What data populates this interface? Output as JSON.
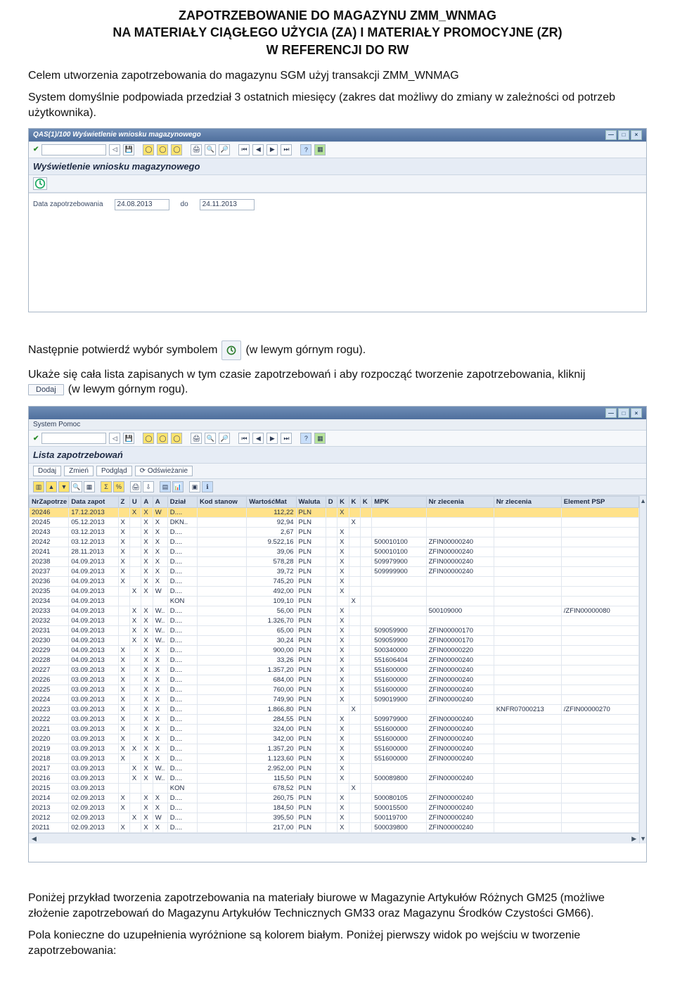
{
  "doc": {
    "title1": "ZAPOTRZEBOWANIE DO MAGAZYNU ZMM_WNMAG",
    "title2": "NA MATERIAŁY CIĄGŁEGO UŻYCIA (ZA) I MATERIAŁY PROMOCYJNE (ZR)",
    "title3": "W REFERENCJI DO RW",
    "p1": "Celem utworzenia zapotrzebowania do magazynu SGM użyj transakcji ZMM_WNMAG",
    "p2": "System domyślnie podpowiada przedział 3 ostatnich miesięcy (zakres dat możliwy do zmiany w zależności od potrzeb użytkownika).",
    "p3a": "Następnie potwierdź wybór symbolem",
    "p3b": "(w lewym górnym rogu).",
    "p4": "Ukaże się cała lista zapisanych w tym czasie zapotrzebowań i aby rozpocząć tworzenie zapotrzebowania, kliknij",
    "p4b": "(w lewym górnym rogu).",
    "p5": "Poniżej przykład tworzenia zapotrzebowania na materiały biurowe w Magazynie Artykułów Różnych GM25 (możliwe złożenie zapotrzebowań do Magazynu Artykułów Technicznych GM33 oraz Magazynu Środków Czystości GM66).",
    "p6": "Pola konieczne do uzupełnienia wyróżnione są kolorem białym. Poniżej pierwszy widok po wejściu w tworzenie zapotrzebowania:"
  },
  "btn": {
    "dodaj": "Dodaj"
  },
  "sap1": {
    "wintitle": "QAS(1)/100 Wyświetlenie wniosku magazynowego",
    "apptitle": "Wyświetlenie wniosku magazynowego",
    "label_date": "Data zapotrzebowania",
    "date_from": "24.08.2013",
    "label_to": "do",
    "date_to": "24.11.2013"
  },
  "sap2": {
    "menu": "System    Pomoc",
    "apptitle": "Lista zapotrzebowań",
    "btn_dodaj": "Dodaj",
    "btn_zmien": "Zmień",
    "btn_podglad": "Podgląd",
    "btn_odswiez": "Odświeżanie",
    "columns": [
      "NrZapotrze",
      "Data zapot",
      "Z",
      "U",
      "A",
      "A",
      "Dział",
      "Kod stanow",
      "WartośćMat",
      "Waluta",
      "D",
      "K",
      "K",
      "K",
      "MPK",
      "Nr zlecenia",
      "Nr zlecenia",
      "Element PSP"
    ],
    "rows": [
      {
        "sel": true,
        "c": [
          "20246",
          "17.12.2013",
          "",
          "X",
          "X",
          "W",
          "D....",
          "",
          "112,22",
          "PLN",
          "",
          "X",
          "",
          "",
          "",
          "",
          "",
          ""
        ]
      },
      {
        "c": [
          "20245",
          "05.12.2013",
          "X",
          "",
          "X",
          "X",
          "DKN..",
          "",
          "92,94",
          "PLN",
          "",
          "",
          "X",
          "",
          "",
          "",
          "",
          ""
        ]
      },
      {
        "c": [
          "20243",
          "03.12.2013",
          "X",
          "",
          "X",
          "X",
          "D....",
          "",
          "2,67",
          "PLN",
          "",
          "X",
          "",
          "",
          "",
          "",
          "",
          ""
        ]
      },
      {
        "c": [
          "20242",
          "03.12.2013",
          "X",
          "",
          "X",
          "X",
          "D....",
          "",
          "9.522,16",
          "PLN",
          "",
          "X",
          "",
          "",
          "500010100",
          "ZFIN00000240",
          "",
          ""
        ]
      },
      {
        "c": [
          "20241",
          "28.11.2013",
          "X",
          "",
          "X",
          "X",
          "D....",
          "",
          "39,06",
          "PLN",
          "",
          "X",
          "",
          "",
          "500010100",
          "ZFIN00000240",
          "",
          ""
        ]
      },
      {
        "c": [
          "20238",
          "04.09.2013",
          "X",
          "",
          "X",
          "X",
          "D....",
          "",
          "578,28",
          "PLN",
          "",
          "X",
          "",
          "",
          "509979900",
          "ZFIN00000240",
          "",
          ""
        ]
      },
      {
        "c": [
          "20237",
          "04.09.2013",
          "X",
          "",
          "X",
          "X",
          "D....",
          "",
          "39,72",
          "PLN",
          "",
          "X",
          "",
          "",
          "509999900",
          "ZFIN00000240",
          "",
          ""
        ]
      },
      {
        "c": [
          "20236",
          "04.09.2013",
          "X",
          "",
          "X",
          "X",
          "D....",
          "",
          "745,20",
          "PLN",
          "",
          "X",
          "",
          "",
          "",
          "",
          "",
          ""
        ]
      },
      {
        "c": [
          "20235",
          "04.09.2013",
          "",
          "X",
          "X",
          "W",
          "D....",
          "",
          "492,00",
          "PLN",
          "",
          "X",
          "",
          "",
          "",
          "",
          "",
          ""
        ]
      },
      {
        "c": [
          "20234",
          "04.09.2013",
          "",
          "",
          "",
          "",
          "KON",
          "",
          "109,10",
          "PLN",
          "",
          "",
          "X",
          "",
          "",
          "",
          "",
          ""
        ]
      },
      {
        "c": [
          "20233",
          "04.09.2013",
          "",
          "X",
          "X",
          "W..",
          "D....",
          "",
          "56,00",
          "PLN",
          "",
          "X",
          "",
          "",
          "",
          "500109000",
          "",
          "/ZFIN00000080"
        ]
      },
      {
        "c": [
          "20232",
          "04.09.2013",
          "",
          "X",
          "X",
          "W..",
          "D....",
          "",
          "1.326,70",
          "PLN",
          "",
          "X",
          "",
          "",
          "",
          "",
          "",
          ""
        ]
      },
      {
        "c": [
          "20231",
          "04.09.2013",
          "",
          "X",
          "X",
          "W..",
          "D....",
          "",
          "65,00",
          "PLN",
          "",
          "X",
          "",
          "",
          "509059900",
          "ZFIN00000170",
          "",
          ""
        ]
      },
      {
        "c": [
          "20230",
          "04.09.2013",
          "",
          "X",
          "X",
          "W..",
          "D....",
          "",
          "30,24",
          "PLN",
          "",
          "X",
          "",
          "",
          "509059900",
          "ZFIN00000170",
          "",
          ""
        ]
      },
      {
        "c": [
          "20229",
          "04.09.2013",
          "X",
          "",
          "X",
          "X",
          "D....",
          "",
          "900,00",
          "PLN",
          "",
          "X",
          "",
          "",
          "500340000",
          "ZFIN00000220",
          "",
          ""
        ]
      },
      {
        "c": [
          "20228",
          "04.09.2013",
          "X",
          "",
          "X",
          "X",
          "D....",
          "",
          "33,26",
          "PLN",
          "",
          "X",
          "",
          "",
          "551606404",
          "ZFIN00000240",
          "",
          ""
        ]
      },
      {
        "c": [
          "20227",
          "03.09.2013",
          "X",
          "",
          "X",
          "X",
          "D....",
          "",
          "1.357,20",
          "PLN",
          "",
          "X",
          "",
          "",
          "551600000",
          "ZFIN00000240",
          "",
          ""
        ]
      },
      {
        "c": [
          "20226",
          "03.09.2013",
          "X",
          "",
          "X",
          "X",
          "D....",
          "",
          "684,00",
          "PLN",
          "",
          "X",
          "",
          "",
          "551600000",
          "ZFIN00000240",
          "",
          ""
        ]
      },
      {
        "c": [
          "20225",
          "03.09.2013",
          "X",
          "",
          "X",
          "X",
          "D....",
          "",
          "760,00",
          "PLN",
          "",
          "X",
          "",
          "",
          "551600000",
          "ZFIN00000240",
          "",
          ""
        ]
      },
      {
        "c": [
          "20224",
          "03.09.2013",
          "X",
          "",
          "X",
          "X",
          "D....",
          "",
          "749,90",
          "PLN",
          "",
          "X",
          "",
          "",
          "509019900",
          "ZFIN00000240",
          "",
          ""
        ]
      },
      {
        "c": [
          "20223",
          "03.09.2013",
          "X",
          "",
          "X",
          "X",
          "D....",
          "",
          "1.866,80",
          "PLN",
          "",
          "",
          "X",
          "",
          "",
          "",
          "KNFR07000213",
          "/ZFIN00000270"
        ]
      },
      {
        "c": [
          "20222",
          "03.09.2013",
          "X",
          "",
          "X",
          "X",
          "D....",
          "",
          "284,55",
          "PLN",
          "",
          "X",
          "",
          "",
          "509979900",
          "ZFIN00000240",
          "",
          ""
        ]
      },
      {
        "c": [
          "20221",
          "03.09.2013",
          "X",
          "",
          "X",
          "X",
          "D....",
          "",
          "324,00",
          "PLN",
          "",
          "X",
          "",
          "",
          "551600000",
          "ZFIN00000240",
          "",
          ""
        ]
      },
      {
        "c": [
          "20220",
          "03.09.2013",
          "X",
          "",
          "X",
          "X",
          "D....",
          "",
          "342,00",
          "PLN",
          "",
          "X",
          "",
          "",
          "551600000",
          "ZFIN00000240",
          "",
          ""
        ]
      },
      {
        "c": [
          "20219",
          "03.09.2013",
          "X",
          "X",
          "X",
          "X",
          "D....",
          "",
          "1.357,20",
          "PLN",
          "",
          "X",
          "",
          "",
          "551600000",
          "ZFIN00000240",
          "",
          ""
        ]
      },
      {
        "c": [
          "20218",
          "03.09.2013",
          "X",
          "",
          "X",
          "X",
          "D....",
          "",
          "1.123,60",
          "PLN",
          "",
          "X",
          "",
          "",
          "551600000",
          "ZFIN00000240",
          "",
          ""
        ]
      },
      {
        "c": [
          "20217",
          "03.09.2013",
          "",
          "X",
          "X",
          "W..",
          "D....",
          "",
          "2.952,00",
          "PLN",
          "",
          "X",
          "",
          "",
          "",
          "",
          "",
          ""
        ]
      },
      {
        "c": [
          "20216",
          "03.09.2013",
          "",
          "X",
          "X",
          "W..",
          "D....",
          "",
          "115,50",
          "PLN",
          "",
          "X",
          "",
          "",
          "500089800",
          "ZFIN00000240",
          "",
          ""
        ]
      },
      {
        "c": [
          "20215",
          "03.09.2013",
          "",
          "",
          "",
          "",
          "KON",
          "",
          "678,52",
          "PLN",
          "",
          "",
          "X",
          "",
          "",
          "",
          "",
          ""
        ]
      },
      {
        "c": [
          "20214",
          "02.09.2013",
          "X",
          "",
          "X",
          "X",
          "D....",
          "",
          "260,75",
          "PLN",
          "",
          "X",
          "",
          "",
          "500080105",
          "ZFIN00000240",
          "",
          ""
        ]
      },
      {
        "c": [
          "20213",
          "02.09.2013",
          "X",
          "",
          "X",
          "X",
          "D....",
          "",
          "184,50",
          "PLN",
          "",
          "X",
          "",
          "",
          "500015500",
          "ZFIN00000240",
          "",
          ""
        ]
      },
      {
        "c": [
          "20212",
          "02.09.2013",
          "",
          "X",
          "X",
          "W",
          "D....",
          "",
          "395,50",
          "PLN",
          "",
          "X",
          "",
          "",
          "500119700",
          "ZFIN00000240",
          "",
          ""
        ]
      },
      {
        "c": [
          "20211",
          "02.09.2013",
          "X",
          "",
          "X",
          "X",
          "D....",
          "",
          "217,00",
          "PLN",
          "",
          "X",
          "",
          "",
          "500039800",
          "ZFIN00000240",
          "",
          ""
        ]
      }
    ]
  }
}
